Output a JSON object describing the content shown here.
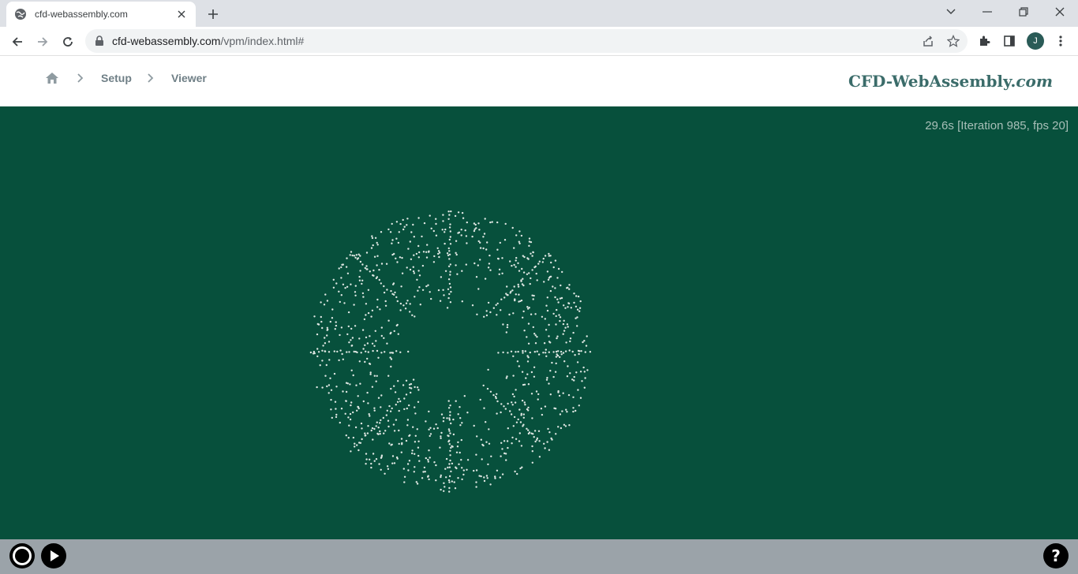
{
  "browser": {
    "tab_title": "cfd-webassembly.com",
    "url_domain": "cfd-webassembly.com",
    "url_path": "/vpm/index.html#",
    "profile_initial": "J"
  },
  "header": {
    "breadcrumb": [
      "Setup",
      "Viewer"
    ],
    "brand_main": "CFD-WebAssembly.",
    "brand_suffix": "com"
  },
  "viewer": {
    "status_text": "29.6s [Iteration 985, fps 20]",
    "particle_color": "#dfe7e3",
    "background_color": "#07503c"
  },
  "colors": {
    "canvas_bg": "#07503c",
    "bottombar_bg": "#9ba3a9",
    "brand": "#3b6c6a"
  }
}
